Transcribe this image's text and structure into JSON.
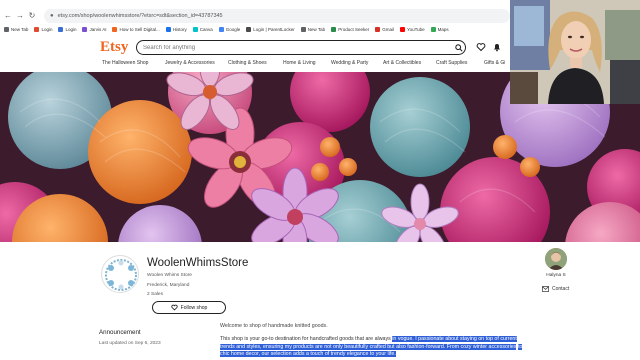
{
  "browser": {
    "url": "etsy.com/shop/woolenwhimsstore/?etsrc=sdt&section_id=43787345",
    "bookmarks": [
      {
        "label": "New Tab",
        "color": "#5f6368"
      },
      {
        "label": "Login",
        "color": "#e04a2f"
      },
      {
        "label": "Login",
        "color": "#3b6fd6"
      },
      {
        "label": "Jarvis AI",
        "color": "#7a4fd1"
      },
      {
        "label": "How to Sell Digital...",
        "color": "#f1641e"
      },
      {
        "label": "History",
        "color": "#1a73e8"
      },
      {
        "label": "Canva",
        "color": "#00c4cc"
      },
      {
        "label": "Google",
        "color": "#4285f4"
      },
      {
        "label": "Login | ParentLocker",
        "color": "#4a4a4a"
      },
      {
        "label": "New Tab",
        "color": "#5f6368"
      },
      {
        "label": "Product Seeker",
        "color": "#2a8c4a"
      },
      {
        "label": "Gmail",
        "color": "#d93025"
      },
      {
        "label": "YouTube",
        "color": "#ff0000"
      },
      {
        "label": "Maps",
        "color": "#34a853"
      }
    ]
  },
  "etsy": {
    "logo": "Etsy",
    "search_placeholder": "Search for anything",
    "brand_color": "#f1641e",
    "nav": [
      "The Halloween Shop",
      "Jewelry & Accessories",
      "Clothing & Shoes",
      "Home & Living",
      "Wedding & Party",
      "Art & Collectibles",
      "Craft Supplies",
      "Gifts & Gi"
    ]
  },
  "shop": {
    "name": "WoolenWhimsStore",
    "tagline": "Woolen Whims Store",
    "location": "Frederick, Maryland",
    "sales": "2 Sales",
    "follow_label": "Follow shop",
    "logo_text": "Woolen Whims Store",
    "owner_name": "Halyna S",
    "contact_label": "Contact"
  },
  "announcement": {
    "title": "Announcement",
    "updated": "Last updated on Sep 6, 2023"
  },
  "about": {
    "welcome": "Welcome to shop of handmade knitted goods.",
    "para_plain": "This shop is your go-to destination for handcrafted goods that are always ",
    "para_highlight_1": "in vogue. I passionate about staying on top of current",
    "para_highlight_2": "trends and styles, ensuring my products are not only beautifully crafted but also fashion-forward. From cozy winter accessories",
    "para_highlight_3": "to chic home decor, our selection adds a touch of trendy elegance to your life."
  }
}
